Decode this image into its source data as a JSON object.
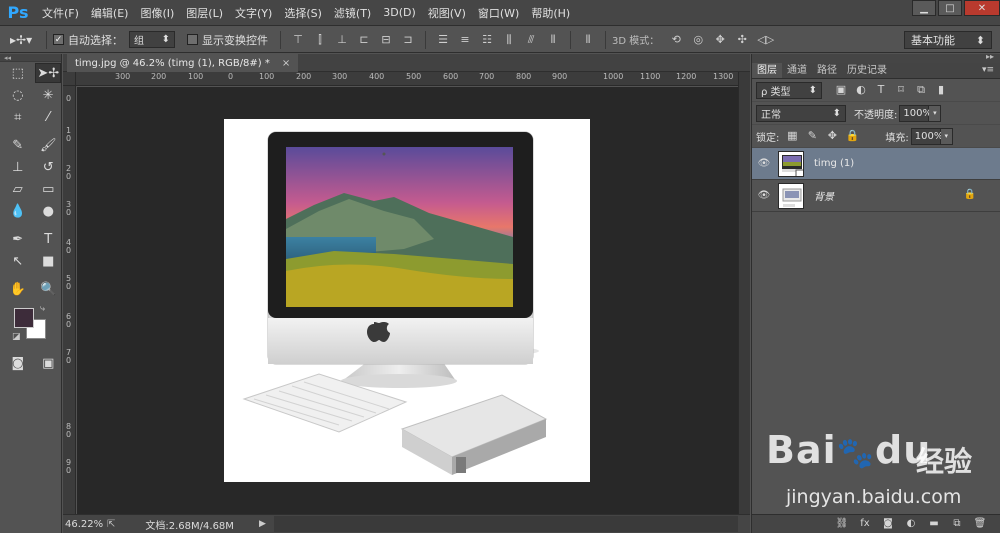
{
  "app": {
    "logo": "Ps",
    "menu": [
      "文件(F)",
      "编辑(E)",
      "图像(I)",
      "图层(L)",
      "文字(Y)",
      "选择(S)",
      "滤镜(T)",
      "3D(D)",
      "视图(V)",
      "窗口(W)",
      "帮助(H)"
    ],
    "window_controls": {
      "minimize": "▁",
      "restore": "□",
      "close": "✕"
    }
  },
  "options": {
    "auto_select_label": "自动选择：",
    "auto_select_checked": "✓",
    "auto_select_value": "组",
    "show_transform_label": "显示变换控件",
    "mode_3d_label": "3D 模式：",
    "workspace": "基本功能"
  },
  "document": {
    "tab_title": "timg.jpg @ 46.2% (timg (1), RGB/8#) *",
    "tab_close": "×",
    "ruler_top": [
      "300",
      "200",
      "100",
      "0",
      "100",
      "200",
      "300",
      "400",
      "500",
      "600",
      "700",
      "800",
      "900",
      "1000",
      "1100",
      "1200",
      "1300"
    ],
    "ruler_left": [
      "0",
      "1",
      "0",
      "2",
      "0",
      "3",
      "0",
      "4",
      "0",
      "5",
      "0",
      "6",
      "0",
      "7",
      "0",
      "8",
      "0",
      "9",
      "0"
    ]
  },
  "status": {
    "zoom": "46.22%",
    "doc_size": "文档:2.68M/4.68M"
  },
  "layers_panel": {
    "tabs": [
      "图层",
      "通道",
      "路径",
      "历史记录"
    ],
    "filter_kind": "ρ 类型",
    "blend_mode": "正常",
    "opacity_label": "不透明度:",
    "opacity_value": "100%",
    "lock_label": "锁定:",
    "fill_label": "填充:",
    "fill_value": "100%",
    "layers": [
      {
        "name": "timg (1)",
        "selected": true
      },
      {
        "name": "背景",
        "selected": false,
        "locked": true
      }
    ]
  },
  "watermark": {
    "brand": "Bai",
    "brand_suffix": "du",
    "cn": "经验",
    "url": "jingyan.baidu.com"
  },
  "colors": {
    "foreground": "#3d2c3a",
    "background": "#ffffff",
    "selected_layer": "#6d7b8d",
    "ps_blue": "#31a8ff"
  }
}
